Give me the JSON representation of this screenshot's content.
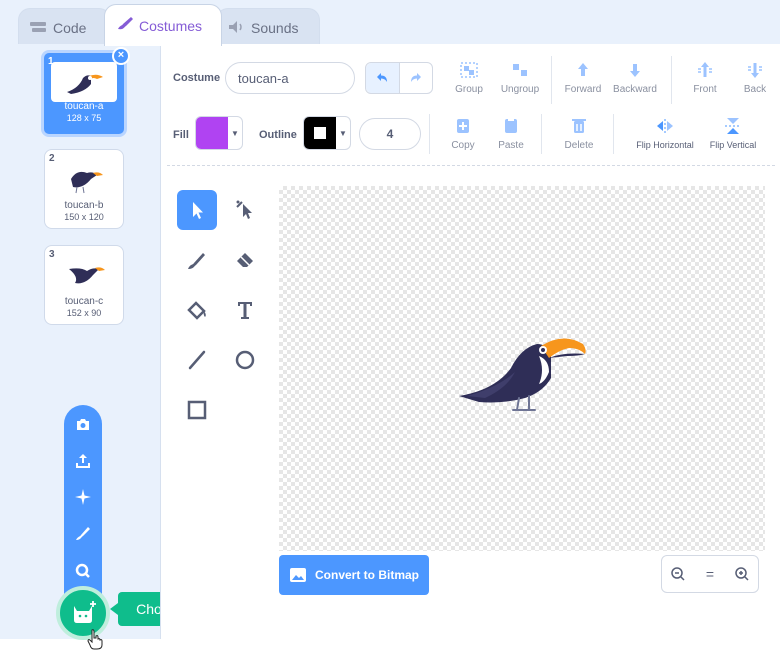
{
  "tabs": [
    {
      "label": "Code",
      "icon": "code-icon"
    },
    {
      "label": "Costumes",
      "icon": "brush-icon"
    },
    {
      "label": "Sounds",
      "icon": "speaker-icon"
    }
  ],
  "costumes": [
    {
      "num": "1",
      "name": "toucan-a",
      "size": "128 x 75",
      "selected": true
    },
    {
      "num": "2",
      "name": "toucan-b",
      "size": "150 x 120",
      "selected": false
    },
    {
      "num": "3",
      "name": "toucan-c",
      "size": "152 x 90",
      "selected": false
    }
  ],
  "add_menu": {
    "items": [
      "camera-icon",
      "upload-icon",
      "surprise-icon",
      "paint-icon",
      "search-icon"
    ],
    "tooltip": "Choose a Costume"
  },
  "editor": {
    "costume_label": "Costume",
    "costume_name": "toucan-a",
    "toolbar1": {
      "group": "Group",
      "ungroup": "Ungroup",
      "forward": "Forward",
      "backward": "Backward",
      "front": "Front",
      "back": "Back"
    },
    "fill_label": "Fill",
    "fill_color": "#b043f2",
    "outline_label": "Outline",
    "outline_color": "#000000",
    "outline_width": "4",
    "toolbar2": {
      "copy": "Copy",
      "paste": "Paste",
      "delete": "Delete",
      "flip_h": "Flip Horizontal",
      "flip_v": "Flip Vertical"
    },
    "tools": [
      "select",
      "reshape",
      "brush",
      "eraser",
      "fill",
      "text",
      "line",
      "circle",
      "rectangle"
    ],
    "convert_label": "Convert to Bitmap",
    "zoom": {
      "out": "−",
      "reset": "=",
      "in": "+"
    }
  },
  "colors": {
    "accent": "#4c97ff",
    "costumes_tab": "#855cd6",
    "add_button": "#0fbd8c"
  }
}
